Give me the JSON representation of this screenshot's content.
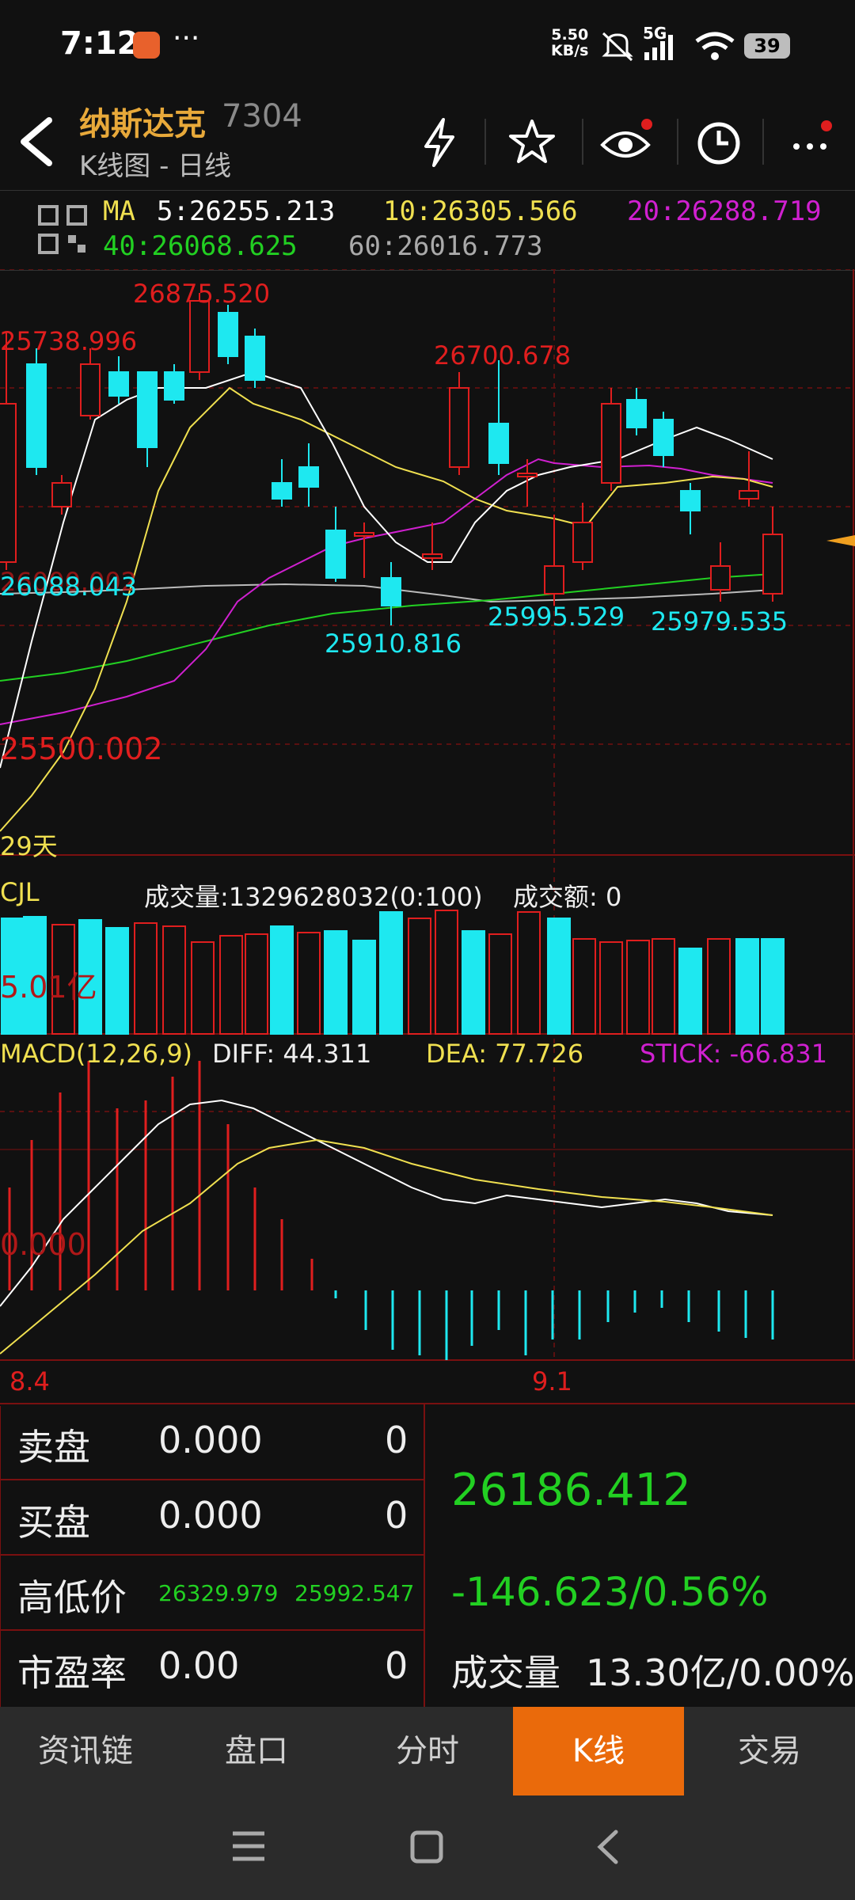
{
  "status": {
    "time": "7:12",
    "dots": "···",
    "net_speed_value": "5.50",
    "net_speed_unit": "KB/s",
    "network": "5G",
    "battery": "39"
  },
  "header": {
    "name": "纳斯达克",
    "code": "7304",
    "subtitle": "K线图 - 日线"
  },
  "ma": {
    "label": "MA",
    "ma5": "5:26255.213",
    "ma10": "10:26305.566",
    "ma20": "20:26288.719",
    "ma40": "40:26068.625",
    "ma60": "60:26016.773"
  },
  "chart": {
    "price_labels": {
      "high": "26875.520",
      "left_high": "25738.996",
      "mid_high": "26700.678",
      "left_low_overlap": "26088.043",
      "left_low_ghost": "26000.002",
      "low1": "25910.816",
      "low2": "25995.529",
      "low3": "25979.535",
      "axis_low": "25500.002",
      "days": "29天"
    },
    "volume": {
      "label": "CJL",
      "volume_text": "成交量:1329628032(0:100)",
      "amount_text": "成交额: 0",
      "axis_label": "5.01亿"
    },
    "macd": {
      "label": "MACD(12,26,9)",
      "diff": "DIFF: 44.311",
      "dea": "DEA: 77.726",
      "stick": "STICK: -66.831",
      "zero": "0.000"
    },
    "dates": {
      "d1": "8.4",
      "d2": "9.1"
    }
  },
  "quote": {
    "sell": {
      "label": "卖盘",
      "price": "0.000",
      "vol": "0"
    },
    "buy": {
      "label": "买盘",
      "price": "0.000",
      "vol": "0"
    },
    "hilo": {
      "label": "高低价",
      "high": "26329.979",
      "low": "25992.547"
    },
    "pe": {
      "label": "市盈率",
      "value": "0.00",
      "vol": "0"
    },
    "last_price": "26186.412",
    "change": "-146.623/0.56%",
    "turnover_label": "成交量",
    "turnover_value": "13.30亿/0.00%"
  },
  "tabs": [
    "资讯链",
    "盘口",
    "分时",
    "K线",
    "交易"
  ],
  "colors": {
    "up": "#e01e1e",
    "down": "#1ee8f0",
    "accent": "#ea6a0b",
    "yellow": "#f0e050",
    "magenta": "#d020d0",
    "green": "#22d022"
  }
}
